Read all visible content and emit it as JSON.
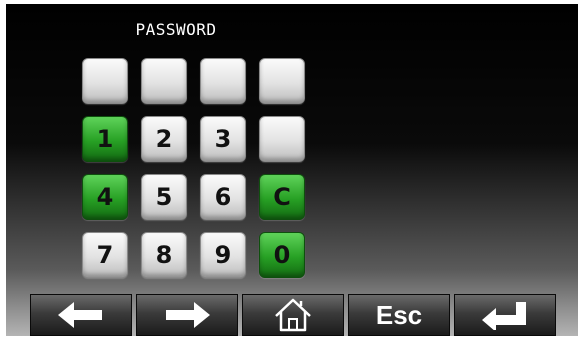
{
  "header": {
    "title": "PASSWORD"
  },
  "keypad": {
    "keys": [
      {
        "label": "",
        "color": "grey"
      },
      {
        "label": "",
        "color": "grey"
      },
      {
        "label": "",
        "color": "grey"
      },
      {
        "label": "",
        "color": "grey"
      },
      {
        "label": "1",
        "color": "green"
      },
      {
        "label": "2",
        "color": "grey"
      },
      {
        "label": "3",
        "color": "grey"
      },
      {
        "label": "",
        "color": "grey"
      },
      {
        "label": "4",
        "color": "green"
      },
      {
        "label": "5",
        "color": "grey"
      },
      {
        "label": "6",
        "color": "grey"
      },
      {
        "label": "C",
        "color": "green"
      },
      {
        "label": "7",
        "color": "grey"
      },
      {
        "label": "8",
        "color": "grey"
      },
      {
        "label": "9",
        "color": "grey"
      },
      {
        "label": "0",
        "color": "green"
      }
    ]
  },
  "nav": {
    "back_icon": "arrow-left-icon",
    "forward_icon": "arrow-right-icon",
    "home_icon": "home-icon",
    "esc_label": "Esc",
    "enter_icon": "enter-icon"
  },
  "colors": {
    "green": "#27a024",
    "grey": "#e2e2e2",
    "bar": "#3b3b3b"
  }
}
